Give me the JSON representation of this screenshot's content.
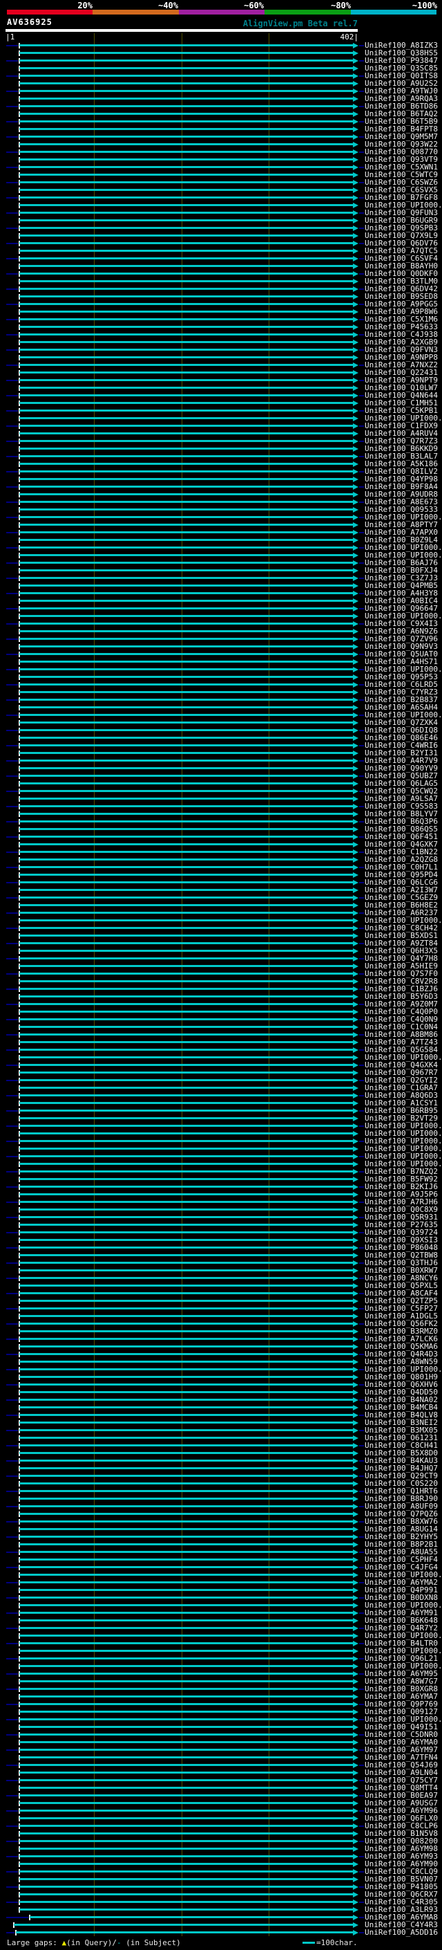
{
  "header": {
    "scale": {
      "labels": [
        "20%",
        "~40%",
        "~60%",
        "~80%",
        "~100%"
      ],
      "colors": [
        "#e4001e",
        "#d2691e",
        "#a020a0",
        "#0a9e14",
        "#00b2c8"
      ]
    },
    "query_id": "AV636925",
    "app_title": "AlignView.pm Beta rel.7",
    "ruler": {
      "start_label": "|1",
      "end_label": "402|",
      "query_length": 402
    }
  },
  "colors": {
    "bar": "#00c8c8",
    "lead": "#000080",
    "grid": "#4e4e00",
    "title": "#00808a",
    "query": "#ffffff",
    "gap_marker": "#e8e800",
    "background": "#000000"
  },
  "rows": [
    "UniRef100_A8IZK3",
    "UniRef100_Q38HS5",
    "UniRef100_P93847",
    "UniRef100_Q3SC85",
    "UniRef100_Q0ITS8",
    "UniRef100_A9U2S2",
    "UniRef100_A9TWJ0",
    "UniRef100_A9RQA3",
    "UniRef100_B6TD86",
    "UniRef100_B6TAQ2",
    "UniRef100_B6T5B9",
    "UniRef100_B4FPT8",
    "UniRef100_Q9M5M7",
    "UniRef100_Q93W22",
    "UniRef100_Q08770",
    "UniRef100_Q93VT9",
    "UniRef100_C5XWN1",
    "UniRef100_C5WTC9",
    "UniRef100_C6SWZ6",
    "UniRef100_C6SVX5",
    "UniRef100_B7FGF8",
    "UniRef100_UPI000..",
    "UniRef100_Q9FUN3",
    "UniRef100_B6UGR9",
    "UniRef100_Q9SPB3",
    "UniRef100_Q7X9L9",
    "UniRef100_Q6DV76",
    "UniRef100_A7QTC5",
    "UniRef100_C6SVF4",
    "UniRef100_B8AYH0",
    "UniRef100_Q0DKF0",
    "UniRef100_B3TLM0",
    "UniRef100_Q6DV42",
    "UniRef100_B9SED8",
    "UniRef100_A9PGG5",
    "UniRef100_A9P8W6",
    "UniRef100_C5X1M6",
    "UniRef100_P45633",
    "UniRef100_C4J938",
    "UniRef100_A2XGB9",
    "UniRef100_Q9FVN3",
    "UniRef100_A9NPP8",
    "UniRef100_A7NXZ2",
    "UniRef100_Q22431",
    "UniRef100_A9NPT9",
    "UniRef100_Q10LW7",
    "UniRef100_Q4N644",
    "UniRef100_C1MH51",
    "UniRef100_C5KPB1",
    "UniRef100_UPI000..",
    "UniRef100_C1FDX9",
    "UniRef100_A4RUV4",
    "UniRef100_Q7R7Z3",
    "UniRef100_B6KKD9",
    "UniRef100_B3LAL7",
    "UniRef100_A5K186",
    "UniRef100_Q8ILV2",
    "UniRef100_Q4YP98",
    "UniRef100_B9F8A4",
    "UniRef100_A9UDR8",
    "UniRef100_A8E673",
    "UniRef100_Q09533",
    "UniRef100_UPI000..",
    "UniRef100_A8PTY7",
    "UniRef100_A7APX0",
    "UniRef100_B0Z9L4",
    "UniRef100_UPI000..",
    "UniRef100_UPI000..",
    "UniRef100_B6AJ76",
    "UniRef100_B0FXJ4",
    "UniRef100_C3Z7J3",
    "UniRef100_Q4PMB5",
    "UniRef100_A4H3Y8",
    "UniRef100_A0BIC4",
    "UniRef100_Q96647",
    "UniRef100_UPI000..",
    "UniRef100_C9X4I3",
    "UniRef100_A6N9Z6",
    "UniRef100_Q7ZV96",
    "UniRef100_Q9N9V3",
    "UniRef100_Q5UAT0",
    "UniRef100_A4HS71",
    "UniRef100_UPI000..",
    "UniRef100_Q95P53",
    "UniRef100_C6LRD5",
    "UniRef100_C7YRZ3",
    "UniRef100_B2B837",
    "UniRef100_A6SAH4",
    "UniRef100_UPI000..",
    "UniRef100_Q7ZXK4",
    "UniRef100_Q6DIQ8",
    "UniRef100_Q86E46",
    "UniRef100_C4WRI6",
    "UniRef100_B2YI31",
    "UniRef100_A4R7V9",
    "UniRef100_Q90YV9",
    "UniRef100_Q5UBZ7",
    "UniRef100_Q6LAG5",
    "UniRef100_Q5CWQ2",
    "UniRef100_A9LSA7",
    "UniRef100_C9S583",
    "UniRef100_B8LYV7",
    "UniRef100_B6Q3P6",
    "UniRef100_Q86QS5",
    "UniRef100_Q6F451",
    "UniRef100_Q4GXK7",
    "UniRef100_C1BN22",
    "UniRef100_A2QZG8",
    "UniRef100_C0H7L1",
    "UniRef100_Q95PD4",
    "UniRef100_Q6LCG6",
    "UniRef100_A2I3W7",
    "UniRef100_C5GEZ9",
    "UniRef100_B6H8E2",
    "UniRef100_A6R237",
    "UniRef100_UPI000..",
    "UniRef100_C8CH42",
    "UniRef100_B5XDS1",
    "UniRef100_A9ZT84",
    "UniRef100_Q6H3X5",
    "UniRef100_Q4Y7H8",
    "UniRef100_A5HIE9",
    "UniRef100_Q7S7F0",
    "UniRef100_C8V2R8",
    "UniRef100_C1BZJ6",
    "UniRef100_B5Y6D3",
    "UniRef100_A9Z0M7",
    "UniRef100_C4Q0P0",
    "UniRef100_C4Q0N9",
    "UniRef100_C1C0N4",
    "UniRef100_A8BM86",
    "UniRef100_A7TZ43",
    "UniRef100_Q5G584",
    "UniRef100_UPI000..",
    "UniRef100_Q4GXK4",
    "UniRef100_Q967R7",
    "UniRef100_Q2GYI2",
    "UniRef100_C1GRA7",
    "UniRef100_A8Q6D3",
    "UniRef100_A1CSY1",
    "UniRef100_B6RB95",
    "UniRef100_B2VT29",
    "UniRef100_UPI000..",
    "UniRef100_UPI000..",
    "UniRef100_UPI000..",
    "UniRef100_UPI000..",
    "UniRef100_UPI000..",
    "UniRef100_UPI000..",
    "UniRef100_B7NZQ2",
    "UniRef100_B5FW92",
    "UniRef100_B2KIJ6",
    "UniRef100_A9J5P6",
    "UniRef100_A7RJH6",
    "UniRef100_Q0C8X9",
    "UniRef100_Q5R931",
    "UniRef100_P27635",
    "UniRef100_Q39724",
    "UniRef100_Q9XSI3",
    "UniRef100_P86048",
    "UniRef100_Q2TBW8",
    "UniRef100_Q3THJ6",
    "UniRef100_B0XRW7",
    "UniRef100_A8NCY6",
    "UniRef100_Q5PXL5",
    "UniRef100_A8CAF4",
    "UniRef100_Q2TZP5",
    "UniRef100_C5FP27",
    "UniRef100_A1DGL5",
    "UniRef100_Q56FK2",
    "UniRef100_B3RMZ0",
    "UniRef100_A7LCK6",
    "UniRef100_Q5KMA6",
    "UniRef100_Q4R4D3",
    "UniRef100_A8WN59",
    "UniRef100_UPI000..",
    "UniRef100_Q801H9",
    "UniRef100_Q6XHV6",
    "UniRef100_Q4DD50",
    "UniRef100_B4NA02",
    "UniRef100_B4MCB4",
    "UniRef100_B4QLV8",
    "UniRef100_B3NEI2",
    "UniRef100_B3MX05",
    "UniRef100_O61231",
    "UniRef100_C8CH41",
    "UniRef100_B5X8D0",
    "UniRef100_B4KAU3",
    "UniRef100_B4JHQ7",
    "UniRef100_Q29CT9",
    "UniRef100_C0S220",
    "UniRef100_Q1HRT6",
    "UniRef100_B8RJ90",
    "UniRef100_A8UF09",
    "UniRef100_Q7PQZ6",
    "UniRef100_B8XW76",
    "UniRef100_A8UG14",
    "UniRef100_B2YHY5",
    "UniRef100_B8P2B1",
    "UniRef100_A8UA55",
    "UniRef100_C5PHF4",
    "UniRef100_C4JFG4",
    "UniRef100_UPI000..",
    "UniRef100_A6YMA2",
    "UniRef100_Q4P991",
    "UniRef100_B0DXN8",
    "UniRef100_UPI000..",
    "UniRef100_A6YM91",
    "UniRef100_B6K648",
    "UniRef100_Q4R7Y2",
    "UniRef100_UPI000..",
    "UniRef100_B4LTR0",
    "UniRef100_UPI000..",
    "UniRef100_Q96L21",
    "UniRef100_UPI000..",
    "UniRef100_A6YM95",
    "UniRef100_A8W7G7",
    "UniRef100_B0XGR8",
    "UniRef100_A6YMA7",
    "UniRef100_Q9P769",
    "UniRef100_Q09127",
    "UniRef100_UPI000..",
    "UniRef100_Q49I51",
    "UniRef100_C5DNR0",
    "UniRef100_A6YMA0",
    "UniRef100_A6YM97",
    "UniRef100_A7TFN4",
    "UniRef100_Q54J69",
    "UniRef100_A9LN04",
    "UniRef100_Q75CY7",
    "UniRef100_Q8MTT4",
    "UniRef100_B0EA97",
    "UniRef100_A9USG7",
    "UniRef100_A6YM96",
    "UniRef100_Q6FLX0",
    "UniRef100_C8CLP6",
    "UniRef100_B1N5V8",
    "UniRef100_Q08200",
    "UniRef100_A6YM98",
    "UniRef100_A6YM93",
    "UniRef100_A6YM90",
    "UniRef100_C8CLQ9",
    "UniRef100_B5VN07",
    "UniRef100_P41805",
    "UniRef100_Q6CRX7",
    "UniRef100_C4R305",
    "UniRef100_A3LR93",
    "UniRef100_A6YMA8",
    "UniRef100_C4Y4R3",
    "UniRef100_A5DD16"
  ],
  "row_overrides": {
    "246": {
      "start": 43
    },
    "247": {
      "start": 20
    },
    "248": {
      "start": 23
    }
  },
  "footer": {
    "gaps_prefix": "Large gaps: ",
    "query_marker": "▲",
    "gaps_mid": "(in Query)/",
    "subject_marker": "-",
    "gaps_suffix": " (in Subject)",
    "legend_label": "=100char."
  }
}
